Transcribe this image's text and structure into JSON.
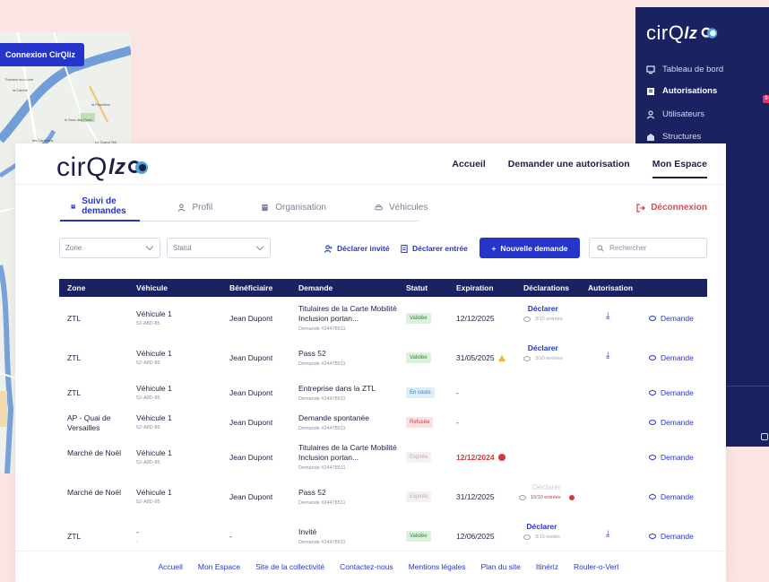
{
  "map_window": {
    "connect_label": "Connexion CirQliz",
    "labels": [
      "Thouaré-sur-Loire",
      "la Cabine",
      "la Plaudière",
      "le Bout des Ponts",
      "les Cantuaris",
      "Le Grand Teil"
    ]
  },
  "side_window": {
    "logo_text": "cirQ",
    "logo_accent": "lz",
    "items": [
      {
        "label": "Tableau de bord",
        "icon": "dashboard-icon"
      },
      {
        "label": "Autorisations",
        "icon": "document-icon",
        "active": true
      },
      {
        "label": "Utilisateurs",
        "icon": "user-icon"
      },
      {
        "label": "Structures",
        "icon": "building-icon"
      }
    ],
    "badge": "9"
  },
  "header": {
    "logo_text": "cirQ",
    "logo_accent": "lz",
    "nav": [
      {
        "label": "Accueil"
      },
      {
        "label": "Demander une autorisation"
      },
      {
        "label": "Mon Espace",
        "active": true
      }
    ]
  },
  "tabs": [
    {
      "label": "Suivi de demandes",
      "icon": "list-icon",
      "active": true
    },
    {
      "label": "Profil",
      "icon": "user-icon"
    },
    {
      "label": "Organisation",
      "icon": "building-icon"
    },
    {
      "label": "Véhicules",
      "icon": "car-icon"
    }
  ],
  "logout_label": "Déconnexion",
  "filters": {
    "zone_placeholder": "Zone",
    "statut_placeholder": "Statut",
    "declare_guest": "Déclarer invité",
    "declare_entry": "Déclarer entrée",
    "new_request": "Nouvelle demande",
    "search_placeholder": "Rechercher"
  },
  "table": {
    "headers": [
      "Zone",
      "Véhicule",
      "Bénéficiaire",
      "Demande",
      "Statut",
      "Expiration",
      "Déclarations",
      "Autorisation"
    ],
    "rows": [
      {
        "zone": "ZTL",
        "vehicle": "Véhicule 1",
        "plate": "52-A8D-85",
        "beneficiary": "Jean Dupont",
        "request": "Titulaires de la Carte Mobilité Inclusion portan...",
        "request_no": "Demande #24478511",
        "status": "Validée",
        "expiration": "12/12/2025",
        "decl_link": "Déclarer",
        "decl_count": "3/10 entrées",
        "download": true,
        "demande": "Demande"
      },
      {
        "zone": "ZTL",
        "vehicle": "Véhicule 1",
        "plate": "52-A8D-85",
        "beneficiary": "Jean Dupont",
        "request": "Pass 52",
        "request_no": "Demande #24478511",
        "status": "Validée",
        "expiration": "31/05/2025",
        "decl_link": "Déclarer",
        "decl_count": "3/10 entrées",
        "download": true,
        "demande": "Demande"
      },
      {
        "zone": "ZTL",
        "vehicle": "Véhicule 1",
        "plate": "52-A8D-85",
        "beneficiary": "Jean Dupont",
        "request": "Entreprise dans la ZTL",
        "request_no": "Demande #24478511",
        "status": "En cours",
        "expiration": "-",
        "demande": "Demande"
      },
      {
        "zone": "AP - Quai de Versailles",
        "vehicle": "Véhicule 1",
        "plate": "52-A8D-85",
        "beneficiary": "Jean Dupont",
        "request": "Demande spontanée",
        "request_no": "Demande #24478511",
        "status": "Refusée",
        "expiration": "-",
        "demande": "Demande"
      },
      {
        "zone": "Marché de Noël",
        "vehicle": "Véhicule 1",
        "plate": "52-A8D-85",
        "beneficiary": "Jean Dupont",
        "request": "Titulaires de la Carte Mobilité Inclusion portan...",
        "request_no": "Demande #24478511",
        "status": "Expirée",
        "expiration": "12/12/2024",
        "demande": "Demande"
      },
      {
        "zone": "Marché de Noël",
        "vehicle": "Véhicule 1",
        "plate": "52-A8D-85",
        "beneficiary": "Jean Dupont",
        "request": "Pass 52",
        "request_no": "Demande #24478511",
        "status": "Expirée",
        "expiration": "31/12/2025",
        "decl_link": "Déclarer",
        "decl_count": "10/10 entrées",
        "demande": "Demande"
      },
      {
        "zone": "ZTL",
        "vehicle": "-",
        "plate": "-",
        "beneficiary": "-",
        "request": "Invité",
        "request_no": "Demande #24478511",
        "status": "Validée",
        "expiration": "12/06/2025",
        "decl_link": "Déclarer",
        "decl_count": "3/10 invités",
        "download": true,
        "demande": "Demande"
      }
    ]
  },
  "footer": [
    "Accueil",
    "Mon Espace",
    "Site de la collectivité",
    "Contactez-nous",
    "Mentions légales",
    "Plan du site",
    "Itinériz",
    "Rouler-o-Vert"
  ],
  "colors": {
    "primary": "#2635c9",
    "navy": "#1a2262",
    "danger": "#e0484c",
    "background": "#fbe4e4"
  }
}
